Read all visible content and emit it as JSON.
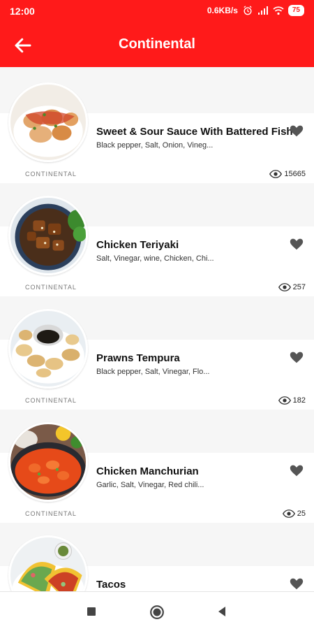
{
  "status_bar": {
    "time": "12:00",
    "network_speed": "0.6KB/s",
    "battery": "75",
    "icons": [
      "alarm-icon",
      "signal-icon",
      "wifi-icon"
    ]
  },
  "app_bar": {
    "title": "Continental",
    "back_icon": "arrow-left-icon"
  },
  "recipes": [
    {
      "name": "Sweet & Sour Sauce With Battered Fish",
      "ingredients": "Black pepper, Salt, Onion, Vineg...",
      "category": "CONTINENTAL",
      "views": "15665"
    },
    {
      "name": "Chicken Teriyaki",
      "ingredients": "Salt, Vinegar, wine, Chicken, Chi...",
      "category": "CONTINENTAL",
      "views": "257"
    },
    {
      "name": "Prawns Tempura",
      "ingredients": "Black pepper, Salt, Vinegar, Flo...",
      "category": "CONTINENTAL",
      "views": "182"
    },
    {
      "name": "Chicken Manchurian",
      "ingredients": "Garlic, Salt, Vinegar, Red chili...",
      "category": "CONTINENTAL",
      "views": "25"
    },
    {
      "name": "Tacos",
      "ingredients": "",
      "category": "",
      "views": ""
    }
  ],
  "colors": {
    "accent": "#ff1a1a",
    "heart": "#555555"
  },
  "nav_bar": {
    "icons": [
      "square-icon",
      "circle-home-icon",
      "triangle-back-icon"
    ]
  }
}
